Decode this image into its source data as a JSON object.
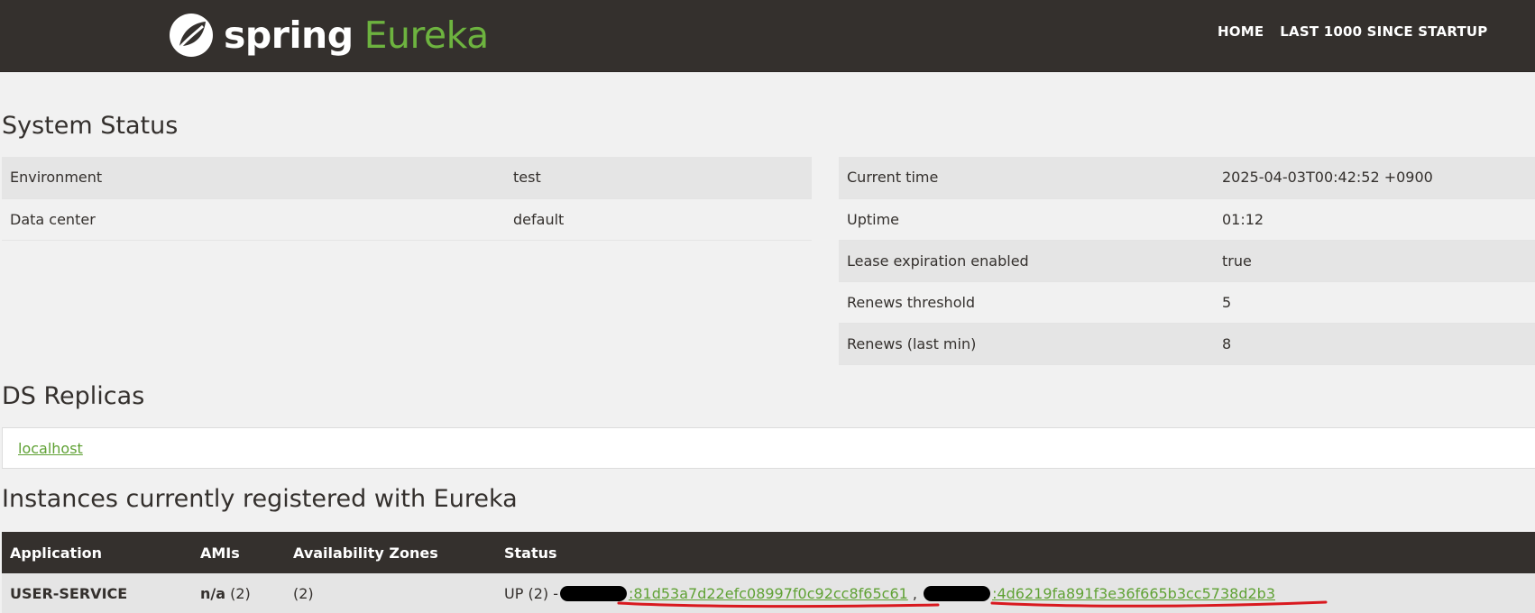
{
  "header": {
    "logo_spring": "spring",
    "logo_eureka": "Eureka",
    "nav": [
      {
        "label": "HOME"
      },
      {
        "label": "LAST 1000 SINCE STARTUP"
      }
    ]
  },
  "system_status": {
    "title": "System Status",
    "left": [
      {
        "key": "Environment",
        "value": "test"
      },
      {
        "key": "Data center",
        "value": "default"
      }
    ],
    "right": [
      {
        "key": "Current time",
        "value": "2025-04-03T00:42:52 +0900"
      },
      {
        "key": "Uptime",
        "value": "01:12"
      },
      {
        "key": "Lease expiration enabled",
        "value": "true"
      },
      {
        "key": "Renews threshold",
        "value": "5"
      },
      {
        "key": "Renews (last min)",
        "value": "8"
      }
    ]
  },
  "ds_replicas": {
    "title": "DS Replicas",
    "items": [
      "localhost"
    ]
  },
  "instances": {
    "title": "Instances currently registered with Eureka",
    "columns": [
      "Application",
      "AMIs",
      "Availability Zones",
      "Status"
    ],
    "rows": [
      {
        "application": "USER-SERVICE",
        "amis_main": "n/a",
        "amis_count": " (2)",
        "zones": "(2)",
        "status_prefix": "UP (2) -",
        "instance_links": [
          ":81d53a7d22efc08997f0c92cc8f65c61",
          ":4d6219fa891f3e36f665b3cc5738d2b3"
        ],
        "separator": " , "
      }
    ]
  },
  "colors": {
    "navbar": "#34302d",
    "accent": "#6db33f",
    "link": "#5fa134",
    "background": "#f1f1f1",
    "annotation": "#d9191f"
  }
}
